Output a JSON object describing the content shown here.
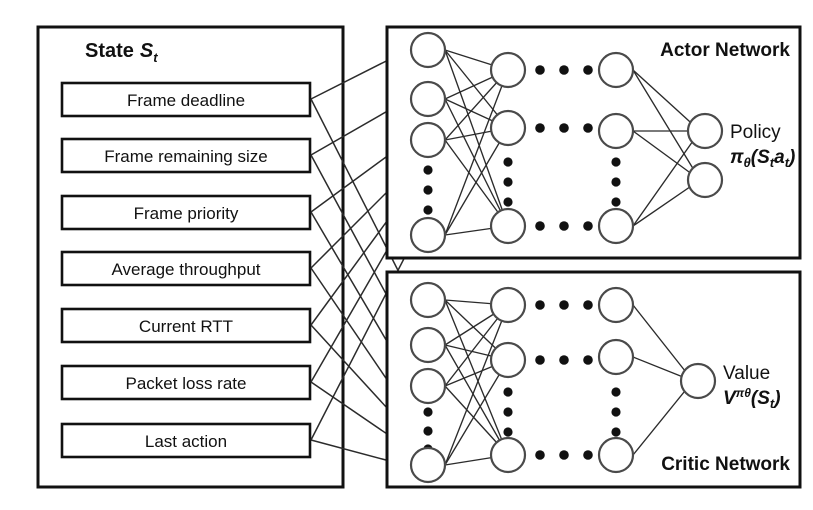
{
  "diagram": {
    "title_state": "State",
    "title_state_symbol": "S",
    "title_state_subscript": "t",
    "state_items": [
      {
        "label": "Frame deadline"
      },
      {
        "label": "Frame remaining size"
      },
      {
        "label": "Frame priority"
      },
      {
        "label": "Average  throughput"
      },
      {
        "label": "Current RTT"
      },
      {
        "label": "Packet loss rate"
      },
      {
        "label": "Last action"
      }
    ],
    "actor": {
      "title": "Actor Network",
      "output_label": "Policy",
      "output_formula_main": "π",
      "output_formula_sub1": "θ",
      "output_formula_rest_open": "(S",
      "output_formula_sub2": "t",
      "output_formula_mid": "a",
      "output_formula_sub3": "t",
      "output_formula_close": ")"
    },
    "critic": {
      "title": "Critic Network",
      "output_label": "Value",
      "output_formula_main": "V",
      "output_formula_sup": "πθ",
      "output_formula_rest_open": "(S",
      "output_formula_sub": "t",
      "output_formula_close": ")"
    },
    "colors": {
      "stroke": "#111111",
      "node_stroke": "#4a4a4a",
      "edge": "#2b2b2b",
      "background": "#ffffff"
    }
  }
}
